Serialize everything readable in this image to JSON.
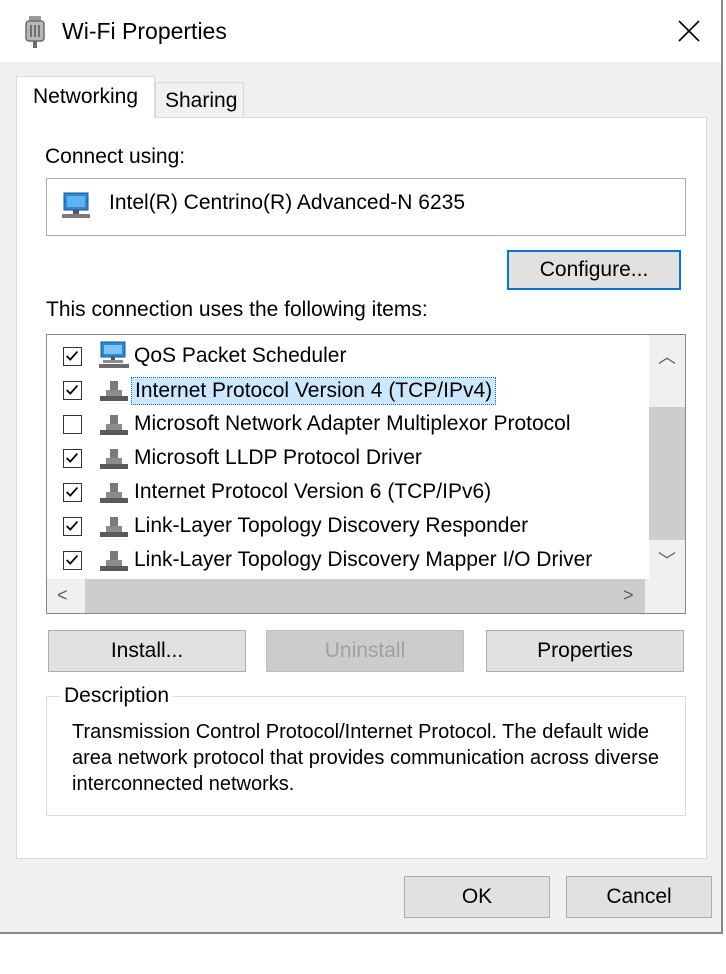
{
  "window": {
    "title": "Wi-Fi Properties"
  },
  "tabs": [
    {
      "label": "Networking",
      "active": true
    },
    {
      "label": "Sharing",
      "active": false
    }
  ],
  "connect_using": {
    "label": "Connect using:",
    "adapter": "Intel(R) Centrino(R) Advanced-N 6235",
    "configure_label": "Configure..."
  },
  "items_section": {
    "label": "This connection uses the following items:",
    "items": [
      {
        "label": "QoS Packet Scheduler",
        "checked": true,
        "icon": "qos-network-icon",
        "selected": false
      },
      {
        "label": "Internet Protocol Version 4 (TCP/IPv4)",
        "checked": true,
        "icon": "protocol-icon",
        "selected": true
      },
      {
        "label": "Microsoft Network Adapter Multiplexor Protocol",
        "checked": false,
        "icon": "protocol-icon",
        "selected": false
      },
      {
        "label": "Microsoft LLDP Protocol Driver",
        "checked": true,
        "icon": "protocol-icon",
        "selected": false
      },
      {
        "label": "Internet Protocol Version 6 (TCP/IPv6)",
        "checked": true,
        "icon": "protocol-icon",
        "selected": false
      },
      {
        "label": "Link-Layer Topology Discovery Responder",
        "checked": true,
        "icon": "protocol-icon",
        "selected": false
      },
      {
        "label": "Link-Layer Topology Discovery Mapper I/O Driver",
        "checked": true,
        "icon": "protocol-icon",
        "selected": false
      }
    ]
  },
  "buttons": {
    "install": "Install...",
    "uninstall": "Uninstall",
    "properties": "Properties",
    "ok": "OK",
    "cancel": "Cancel"
  },
  "description": {
    "legend": "Description",
    "text": "Transmission Control Protocol/Internet Protocol. The default wide area network protocol that provides communication across diverse interconnected networks."
  },
  "colors": {
    "accent": "#0078d7",
    "selection": "#cce8ff",
    "face": "#f0f0f0",
    "button": "#e1e1e1"
  }
}
